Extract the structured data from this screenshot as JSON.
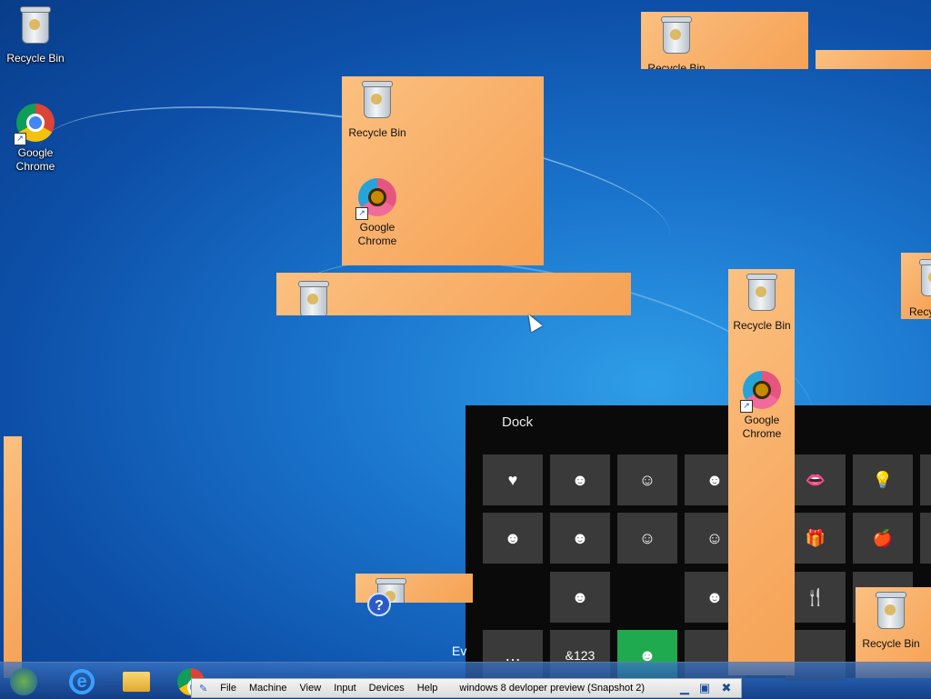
{
  "desktop": {
    "icons": [
      {
        "label": "Recycle Bin",
        "icon": "recycle-bin-icon"
      },
      {
        "label": "Google Chrome",
        "icon": "chrome-icon"
      }
    ],
    "ghost_icons": {
      "tile_a_bin": "Recycle Bin",
      "tile_a_chrome": "Google Chrome",
      "tile_c_bin": "Recycle Bin",
      "tile_c_chrome": "Google Chrome",
      "tile_d_bin": "Recycle Bin",
      "tile_e_bin": "Recycle Bin",
      "tile_f_bin": "Recyc"
    },
    "partial_text": "Ev"
  },
  "dock": {
    "title": "Dock",
    "keys": [
      [
        "♥",
        "☻",
        "☺",
        "☻",
        "",
        "👄",
        "💡"
      ],
      [
        "☻",
        "☻",
        "☺",
        "☺",
        "",
        "🎁",
        "🍎"
      ],
      [
        "",
        "",
        "☻",
        "",
        "☻",
        "🍴",
        ""
      ],
      [
        "…",
        "&123",
        "☻",
        "",
        "",
        "",
        ""
      ]
    ]
  },
  "taskbar": {
    "start": "start-orb-icon",
    "pinned": [
      "internet-explorer-icon",
      "file-explorer-icon",
      "chrome-icon"
    ]
  },
  "vbox": {
    "menus": [
      "File",
      "Machine",
      "View",
      "Input",
      "Devices",
      "Help"
    ],
    "title": "windows 8 devloper preview (Snapshot 2)"
  },
  "colors": {
    "tile": "#f8b06a",
    "dock_bg": "#0a0a0a",
    "key_bg": "#3a3a3a",
    "key_active": "#1faa4f"
  }
}
